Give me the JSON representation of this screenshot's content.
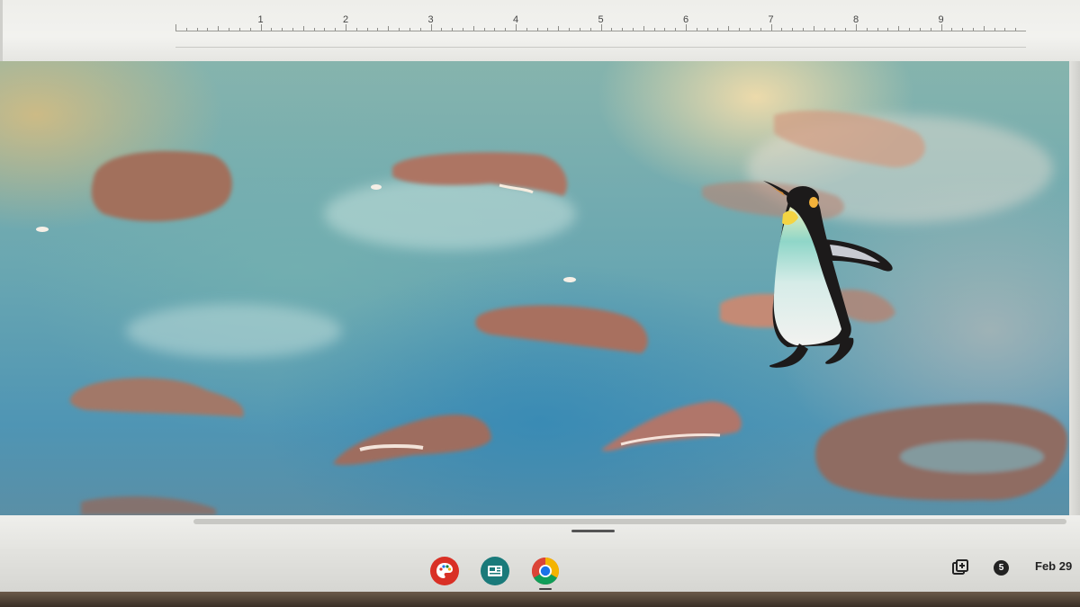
{
  "ruler": {
    "numbers": [
      "1",
      "2",
      "3",
      "4",
      "5",
      "6",
      "7",
      "8",
      "9"
    ]
  },
  "canvas": {
    "description_icon": "penguin-illustration",
    "water_color": "#5f9fb3",
    "rock_color": "#a86f5c"
  },
  "shelf": {
    "apps": [
      {
        "name": "palette-icon",
        "color": "#d93025"
      },
      {
        "name": "screencast-icon",
        "color": "#1a7a7a"
      },
      {
        "name": "chrome-icon",
        "color": "#1a73e8"
      }
    ],
    "tray": {
      "notification_count": "5",
      "date": "Feb 29"
    }
  }
}
